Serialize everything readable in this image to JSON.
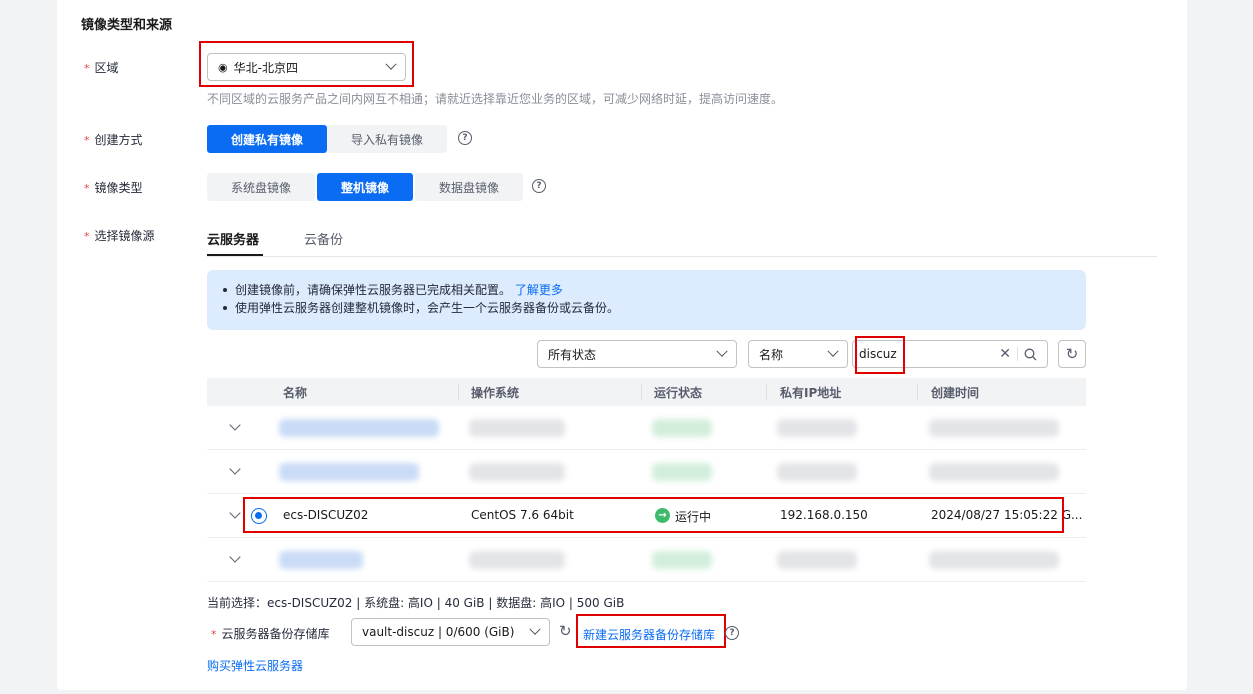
{
  "section_title": "镜像类型和来源",
  "region": {
    "label": "区域",
    "value": "华北-北京四",
    "hint": "不同区域的云服务产品之间内网互不相通；请就近选择靠近您业务的区域，可减少网络时延，提高访问速度。"
  },
  "create_method": {
    "label": "创建方式",
    "options": [
      "创建私有镜像",
      "导入私有镜像"
    ],
    "selected": "创建私有镜像"
  },
  "image_type": {
    "label": "镜像类型",
    "options": [
      "系统盘镜像",
      "整机镜像",
      "数据盘镜像"
    ],
    "selected": "整机镜像"
  },
  "image_source": {
    "label": "选择镜像源",
    "tabs": [
      "云服务器",
      "云备份"
    ],
    "active_tab": "云服务器"
  },
  "info": {
    "line1": "创建镜像前，请确保弹性云服务器已完成相关配置。",
    "learn_more": "了解更多",
    "line2": "使用弹性云服务器创建整机镜像时，会产生一个云服务器备份或云备份。"
  },
  "filters": {
    "status": "所有状态",
    "field": "名称",
    "search_value": "discuz"
  },
  "table": {
    "columns": [
      "名称",
      "操作系统",
      "运行状态",
      "私有IP地址",
      "创建时间"
    ],
    "selected_row": {
      "name": "ecs-DISCUZ02",
      "os": "CentOS 7.6 64bit",
      "status": "运行中",
      "ip": "192.168.0.150",
      "created": "2024/08/27 15:05:22 G..."
    }
  },
  "current_selection": "当前选择：ecs-DISCUZ02 | 系统盘: 高IO | 40 GiB | 数据盘: 高IO | 500 GiB",
  "vault": {
    "label": "云服务器备份存储库",
    "value": "vault-discuz | 0/600 (GiB)",
    "create_link": "新建云服务器备份存储库"
  },
  "buy_link": "购买弹性云服务器",
  "colors": {
    "primary": "#0a6cf2",
    "required": "#e54545",
    "highlight": "#e00000",
    "running": "#3dba6a"
  }
}
